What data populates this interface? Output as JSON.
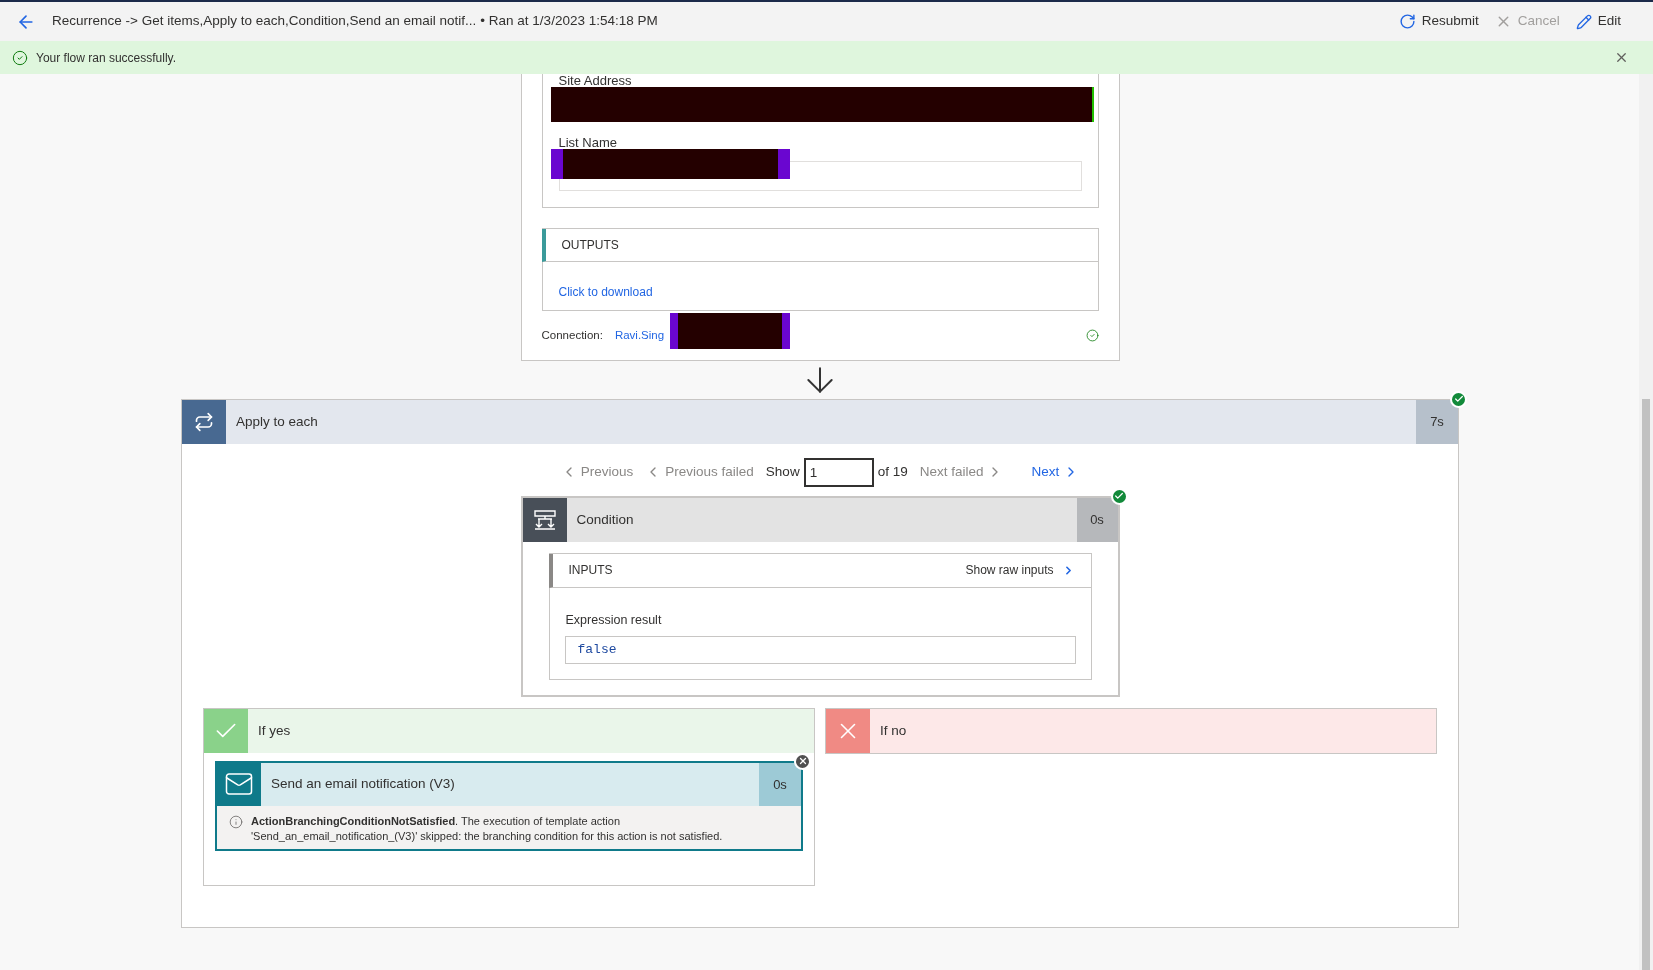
{
  "header": {
    "title": "Recurrence -> Get items,Apply to each,Condition,Send an email notif...",
    "run_time": "• Ran at 1/3/2023 1:54:18 PM",
    "actions": [
      {
        "kind": "resubmit",
        "label": "Resubmit",
        "disabled": false
      },
      {
        "kind": "cancel",
        "label": "Cancel",
        "disabled": true
      },
      {
        "kind": "edit",
        "label": "Edit",
        "disabled": false
      }
    ]
  },
  "banner": {
    "message": "Your flow ran successfully."
  },
  "get_items": {
    "fields": [
      {
        "label": "Site Address",
        "redacted": true
      },
      {
        "label": "List Name",
        "redacted": true
      }
    ],
    "outputs": {
      "title": "OUTPUTS",
      "link": "Click to download"
    },
    "connection": {
      "label": "Connection:",
      "value": "Ravi.Sing"
    }
  },
  "apply_to_each": {
    "title": "Apply to each",
    "duration": "7s",
    "succeeded": true,
    "pager": [
      {
        "kind": "prev",
        "label": "Previous",
        "disabled": true
      },
      {
        "kind": "prev",
        "label": "Previous failed",
        "disabled": true
      },
      {
        "kind": "show",
        "label": "Show",
        "value": "1",
        "total": "of 19"
      },
      {
        "kind": "next",
        "label": "Next failed",
        "disabled": true
      },
      {
        "kind": "next",
        "label": "Next",
        "disabled": false
      }
    ]
  },
  "condition": {
    "title": "Condition",
    "duration": "0s",
    "succeeded": true,
    "inputs_title": "INPUTS",
    "raw_link": "Show raw inputs",
    "field_label": "Expression result",
    "field_value": "false"
  },
  "branches": [
    {
      "kind": "yes",
      "label": "If yes"
    },
    {
      "kind": "no",
      "label": "If no"
    }
  ],
  "email_action": {
    "title": "Send an email notification (V3)",
    "duration": "0s",
    "skipped": true,
    "message": "**ActionBranchingConditionNotSatisfied**. The execution of template action 'Send_an_email_notification_(V3)' skipped: the branching condition for this action is not satisfied."
  }
}
